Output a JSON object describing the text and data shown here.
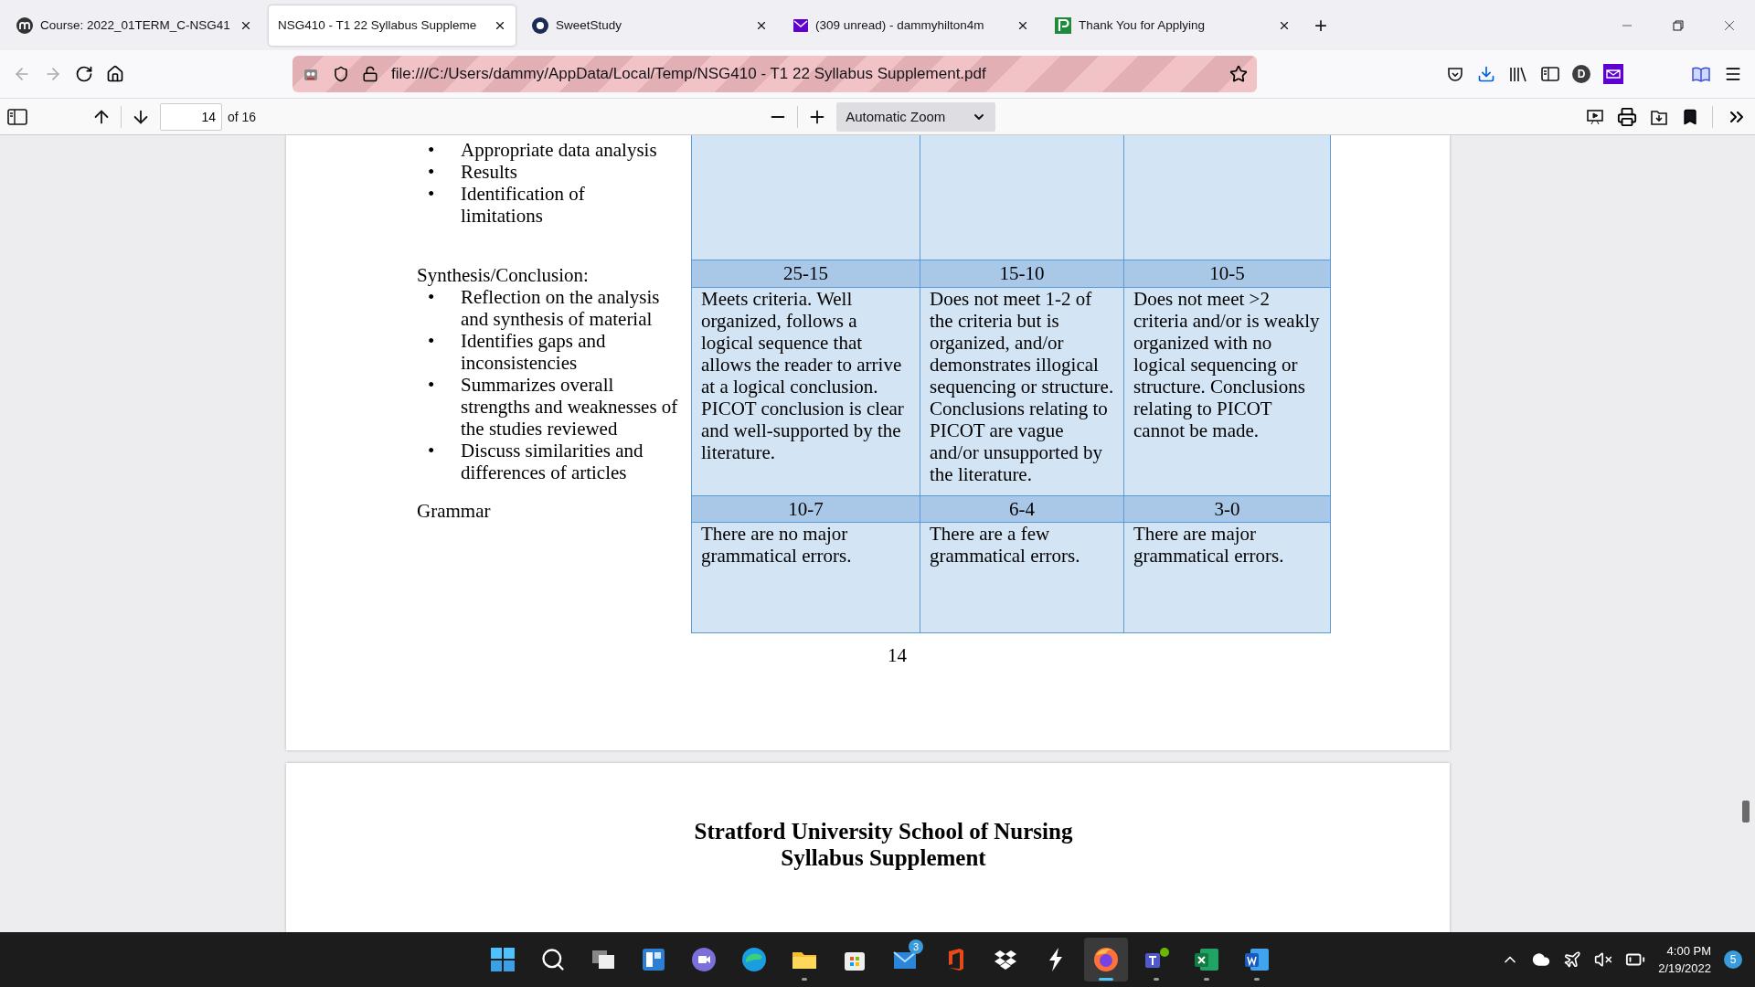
{
  "tabs": [
    {
      "label": "Course: 2022_01TERM_C-NSG41",
      "kind": "moodle",
      "selected": false
    },
    {
      "label": "NSG410 - T1 22 Syllabus Suppleme",
      "kind": "plain",
      "selected": true
    },
    {
      "label": "SweetStudy",
      "kind": "ring",
      "selected": false
    },
    {
      "label": "(309 unread) - dammyhilton4m",
      "kind": "mail",
      "selected": false
    },
    {
      "label": "Thank You for Applying",
      "kind": "paylocity",
      "selected": false
    }
  ],
  "new_tab": "+",
  "address": {
    "url": "file:///C:/Users/dammy/AppData/Local/Temp/NSG410 - T1 22 Syllabus Supplement.pdf"
  },
  "profile_initial": "D",
  "pdf_toolbar": {
    "page": "14",
    "page_count": "of 16",
    "zoom": "Automatic Zoom"
  },
  "page": {
    "top_bullets": [
      {
        "marker": "•",
        "text": "Appropriate data analysis"
      },
      {
        "marker": "•",
        "text": "Results"
      },
      {
        "marker": "•",
        "text": "Identification of limitations"
      }
    ],
    "sections": [
      {
        "title": "Synthesis/Conclusion:",
        "bullets": [
          {
            "marker": "•",
            "text": "Reflection on the analysis and synthesis of material"
          },
          {
            "marker": "•",
            "text": "Identifies gaps and inconsistencies"
          },
          {
            "marker": "•",
            "text": "Summarizes overall strengths and weaknesses of the studies reviewed"
          },
          {
            "marker": "•",
            "text": "Discuss similarities and differences of articles"
          }
        ],
        "scores": [
          "25-15",
          "15-10",
          "10-5"
        ],
        "descriptions": [
          "Meets criteria. Well organized, follows a logical sequence that allows the reader to arrive at a logical conclusion. PICOT conclusion is clear and well-supported by the literature.",
          "Does not meet 1-2 of the criteria but is organized, and/or demonstrates illogical sequencing or structure. Conclusions relating to PICOT are vague and/or unsupported by the literature.",
          "Does not meet >2 criteria and/or is weakly organized with no logical sequencing or structure. Conclusions relating to PICOT cannot be made."
        ]
      },
      {
        "title": "Grammar",
        "scores": [
          "10-7",
          "6-4",
          "3-0"
        ],
        "descriptions": [
          "There are no major grammatical errors.",
          "There are a few grammatical errors.",
          "There are major grammatical errors."
        ]
      }
    ],
    "page_number": "14"
  },
  "next_page": {
    "title_lines": [
      "Stratford University School of Nursing",
      "Syllabus Supplement"
    ]
  },
  "taskbar": {
    "apps": [
      {
        "kind": "start",
        "running": false,
        "active": false
      },
      {
        "kind": "search",
        "running": false,
        "active": false
      },
      {
        "kind": "taskview",
        "running": false,
        "active": false
      },
      {
        "kind": "widgets",
        "running": false,
        "active": false
      },
      {
        "kind": "chat",
        "running": false,
        "active": false
      },
      {
        "kind": "edge",
        "running": false,
        "active": false
      },
      {
        "kind": "explorer",
        "running": true,
        "active": false
      },
      {
        "kind": "store",
        "running": false,
        "active": false
      },
      {
        "kind": "mail",
        "running": false,
        "active": false,
        "badge": "3"
      },
      {
        "kind": "office",
        "running": false,
        "active": false
      },
      {
        "kind": "dropbox",
        "running": false,
        "active": false
      },
      {
        "kind": "bolt",
        "running": false,
        "active": false
      },
      {
        "kind": "firefox",
        "running": true,
        "active": true
      },
      {
        "kind": "teams",
        "running": true,
        "active": false
      },
      {
        "kind": "excel",
        "running": true,
        "active": false
      },
      {
        "kind": "word",
        "running": true,
        "active": false
      }
    ],
    "time": "4:00 PM",
    "date": "2/19/2022",
    "notifications": "5"
  }
}
